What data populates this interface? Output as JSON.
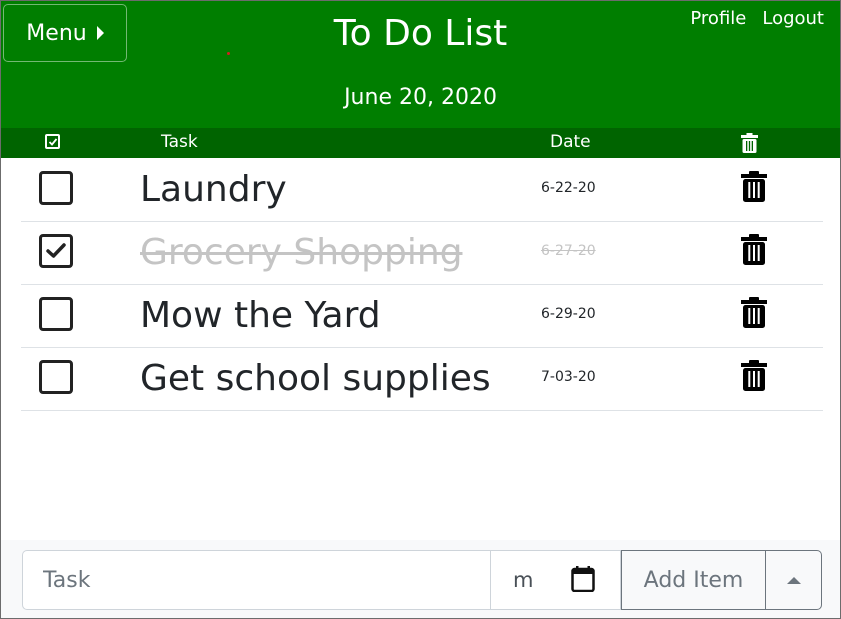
{
  "header": {
    "menu_label": "Menu",
    "title": "To Do List",
    "date": "June 20, 2020",
    "nav": {
      "profile": "Profile",
      "logout": "Logout"
    },
    "color": "#007e00"
  },
  "table": {
    "headers": {
      "task": "Task",
      "date": "Date"
    },
    "header_color": "#006400",
    "rows": [
      {
        "task": "Laundry",
        "date": "6-22-20",
        "done": false
      },
      {
        "task": "Grocery Shopping",
        "date": "6-27-20",
        "done": true
      },
      {
        "task": "Mow the Yard",
        "date": "6-29-20",
        "done": false
      },
      {
        "task": "Get school supplies",
        "date": "7-03-20",
        "done": false
      }
    ]
  },
  "footer": {
    "task_placeholder": "Task",
    "date_value": "m",
    "add_label": "Add Item"
  }
}
